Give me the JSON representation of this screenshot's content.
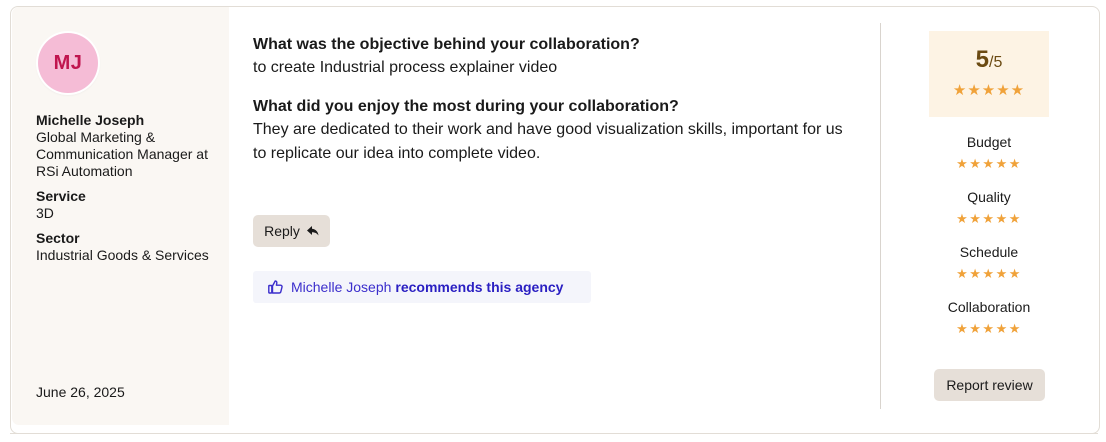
{
  "reviewer": {
    "initials": "MJ",
    "name": "Michelle Joseph",
    "title": "Global Marketing & Communication Manager at RSi Automation",
    "service_label": "Service",
    "service_value": "3D",
    "sector_label": "Sector",
    "sector_value": "Industrial Goods & Services",
    "date": "June 26, 2025"
  },
  "qa": [
    {
      "question": "What was the objective behind your collaboration?",
      "answer": "to create Industrial process explainer video"
    },
    {
      "question": "What did you enjoy the most during your collaboration?",
      "answer": "They are dedicated to their work and have good visualization skills, important for us to replicate our idea into complete video."
    }
  ],
  "actions": {
    "reply_label": "Reply",
    "report_label": "Report review"
  },
  "recommendation": {
    "name": "Michelle Joseph",
    "text": "recommends this agency"
  },
  "overall": {
    "score": "5",
    "out_of": "/5",
    "stars": "★★★★★",
    "rating": 5
  },
  "ratings": [
    {
      "label": "Budget",
      "stars": "★★★★★",
      "value": 5
    },
    {
      "label": "Quality",
      "stars": "★★★★★",
      "value": 5
    },
    {
      "label": "Schedule",
      "stars": "★★★★★",
      "value": 5
    },
    {
      "label": "Collaboration",
      "stars": "★★★★★",
      "value": 5
    }
  ],
  "colors": {
    "star": "#f0a23a",
    "accent_link": "#2a1fc2",
    "avatar_bg": "#f5bcd6",
    "avatar_text": "#c0154f"
  }
}
